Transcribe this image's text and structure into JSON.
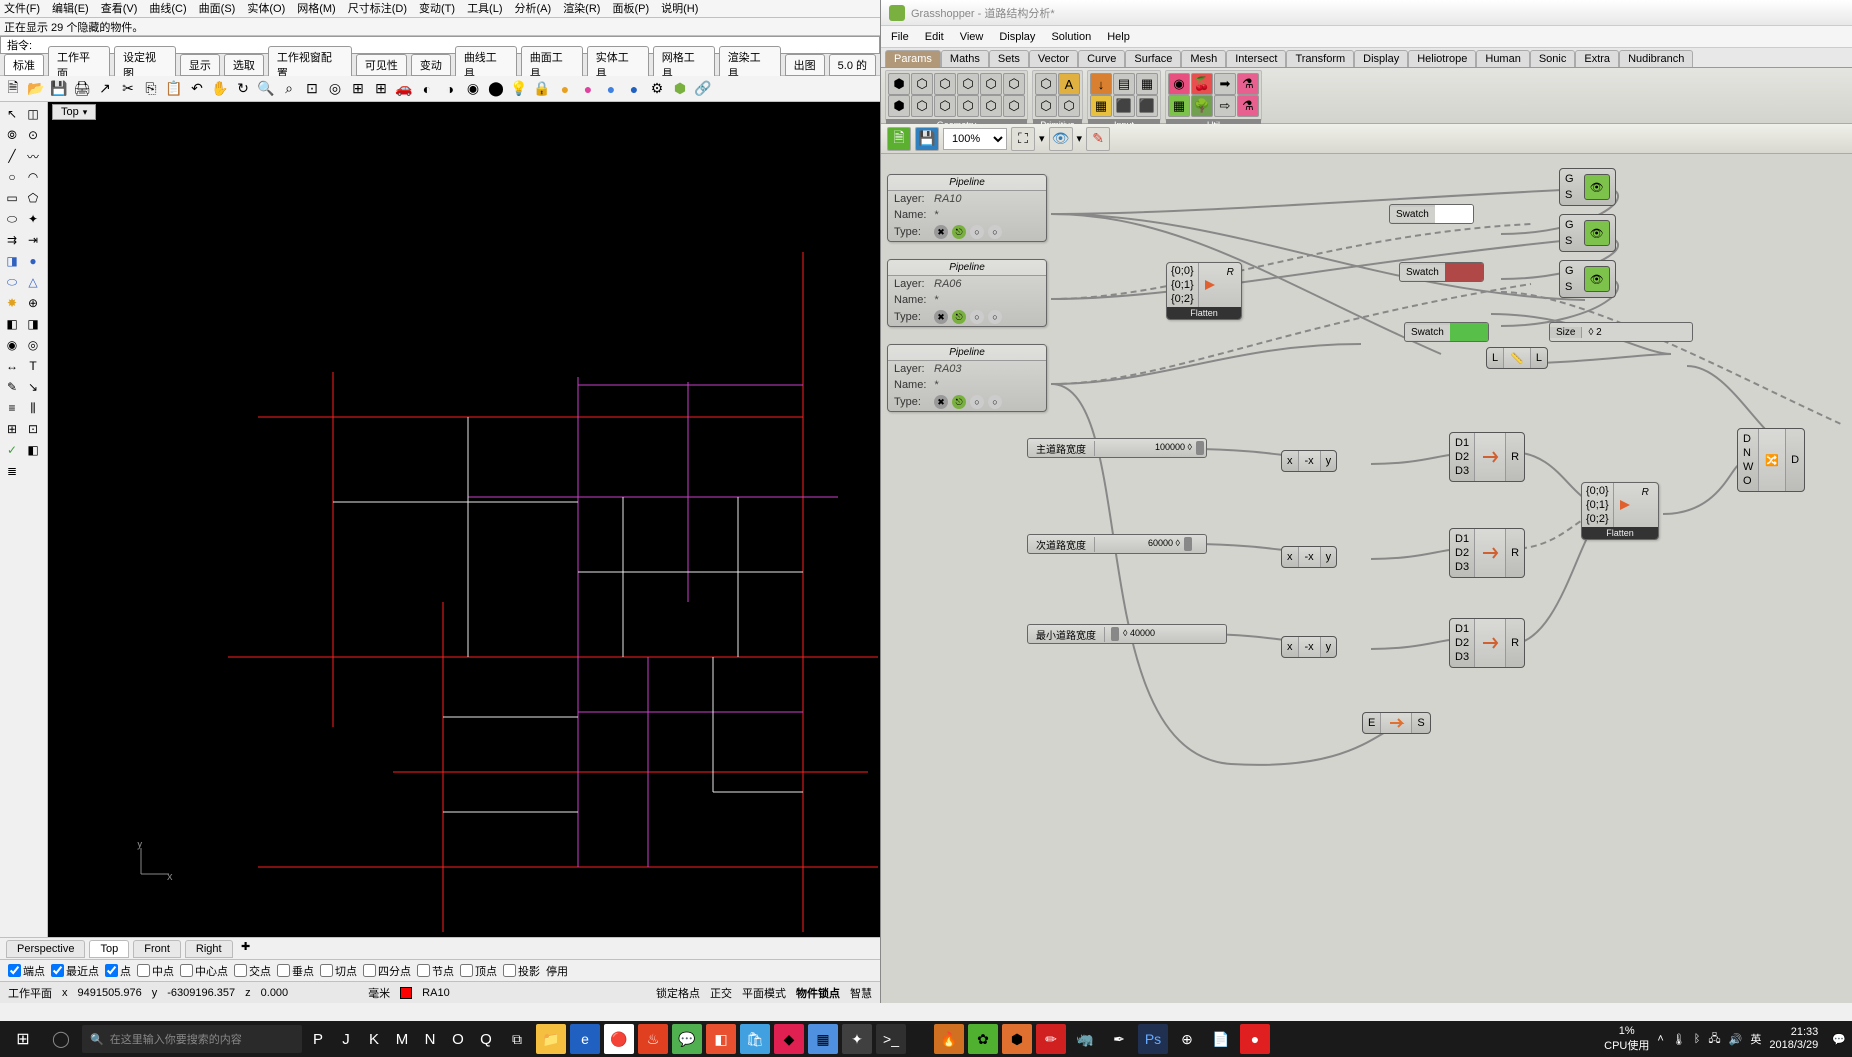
{
  "rhino": {
    "menu": [
      "文件(F)",
      "编辑(E)",
      "查看(V)",
      "曲线(C)",
      "曲面(S)",
      "实体(O)",
      "网格(M)",
      "尺寸标注(D)",
      "变动(T)",
      "工具(L)",
      "分析(A)",
      "渲染(R)",
      "面板(P)",
      "说明(H)"
    ],
    "status_line": "正在显示 29 个隐藏的物件。",
    "cmd_label": "指令:",
    "tabs": [
      "标准",
      "工作平面",
      "设定视图",
      "显示",
      "选取",
      "工作视窗配置",
      "可见性",
      "变动",
      "曲线工具",
      "曲面工具",
      "实体工具",
      "网格工具",
      "渲染工具",
      "出图",
      "5.0 的"
    ],
    "active_tab": "标准",
    "viewport_label": "Top",
    "view_tabs": [
      "Perspective",
      "Top",
      "Front",
      "Right"
    ],
    "active_view": "Top",
    "osnap": {
      "items": [
        "端点",
        "最近点",
        "点",
        "中点",
        "中心点",
        "交点",
        "垂点",
        "切点",
        "四分点",
        "节点",
        "顶点",
        "投影",
        "停用"
      ],
      "checked": [
        "端点",
        "最近点",
        "点"
      ]
    },
    "bottom": {
      "pane": "工作平面",
      "x_lbl": "x",
      "x_val": "9491505.976",
      "y_lbl": "y",
      "y_val": "-6309196.357",
      "z_lbl": "z",
      "z_val": "0.000",
      "unit": "毫米",
      "layer": "RA10",
      "items": [
        "锁定格点",
        "正交",
        "平面模式",
        "物件锁点",
        "智慧"
      ]
    }
  },
  "gh": {
    "title": "Grasshopper - 道路结构分析*",
    "menu": [
      "File",
      "Edit",
      "View",
      "Display",
      "Solution",
      "Help"
    ],
    "tabs": [
      "Params",
      "Maths",
      "Sets",
      "Vector",
      "Curve",
      "Surface",
      "Mesh",
      "Intersect",
      "Transform",
      "Display",
      "Heliotrope",
      "Human",
      "Sonic",
      "Extra",
      "Nudibranch"
    ],
    "active_tab": "Params",
    "groups": [
      "Geometry",
      "Primitive",
      "Input",
      "Util"
    ],
    "zoom": "100%",
    "pipelines": [
      {
        "title": "Pipeline",
        "layer": "RA10",
        "name": "*",
        "type": "*"
      },
      {
        "title": "Pipeline",
        "layer": "RA06",
        "name": "*",
        "type": "*"
      },
      {
        "title": "Pipeline",
        "layer": "RA03",
        "name": "*",
        "type": "*"
      }
    ],
    "pipeline_labels": {
      "layer": "Layer:",
      "name": "Name:",
      "type": "Type:"
    },
    "flatten": {
      "paths": [
        "{0;0}",
        "{0;1}",
        "{0;2}"
      ],
      "r": "R",
      "btm": "Flatten"
    },
    "flatten2": {
      "paths": [
        "{0;0}",
        "{0;1}",
        "{0;2}"
      ],
      "r": "R",
      "btm": "Flatten"
    },
    "swatches": [
      {
        "label": "Swatch",
        "color": "#ffffff"
      },
      {
        "label": "Swatch",
        "color": "#b04848"
      },
      {
        "label": "Swatch",
        "color": "#58c048"
      }
    ],
    "size": {
      "label": "Size",
      "value": "◊ 2"
    },
    "sliders": [
      {
        "label": "主道路宽度",
        "value": "100000 ◊"
      },
      {
        "label": "次道路宽度",
        "value": "60000 ◊"
      },
      {
        "label": "最小道路宽度",
        "value": "◊ 40000"
      }
    ],
    "vec": {
      "x": "x",
      "y": "y",
      "icon": "↔"
    },
    "move": {
      "d1": "D1",
      "d2": "D2",
      "d3": "D3",
      "r": "R"
    },
    "final": {
      "d": "D",
      "n": "N",
      "w": "W",
      "o": "O",
      "out": "D"
    },
    "es": {
      "e": "E",
      "s": "S"
    },
    "len": {
      "l_in": "L",
      "l_out": "L"
    }
  },
  "taskbar": {
    "search_placeholder": "在这里输入你要搜索的内容",
    "letters": [
      "P",
      "J",
      "K",
      "M",
      "N",
      "O",
      "Q"
    ],
    "cpu_pct": "1%",
    "cpu_label": "CPU使用",
    "time": "21:33",
    "date": "2018/3/29",
    "lang": "英"
  }
}
